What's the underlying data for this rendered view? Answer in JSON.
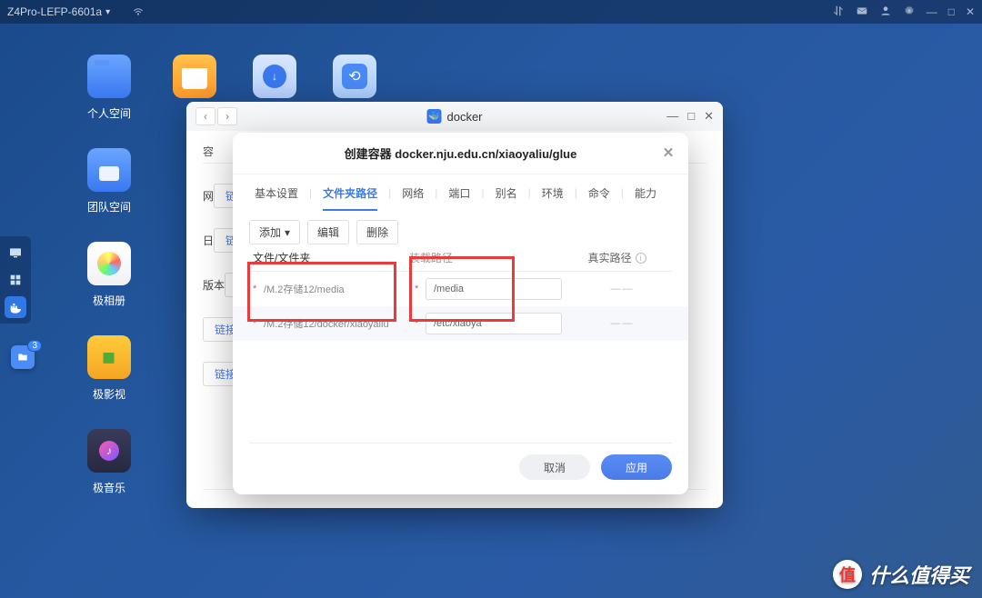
{
  "topbar": {
    "title": "Z4Pro-LEFP-6601a"
  },
  "desktop": {
    "col1": [
      {
        "label": "个人空间"
      },
      {
        "label": "团队空间"
      },
      {
        "label": "极相册"
      },
      {
        "label": "极影视"
      },
      {
        "label": "极音乐"
      }
    ]
  },
  "docker_window": {
    "title": "docker",
    "body": {
      "tab_left": "容",
      "side1": "网",
      "side2": "日",
      "side3": "版本",
      "pill_btn": "链接",
      "bottom1": "",
      "bottom2": ""
    }
  },
  "modal": {
    "title": "创建容器 docker.nju.edu.cn/xiaoyaliu/glue",
    "tabs": [
      "基本设置",
      "文件夹路径",
      "网络",
      "端口",
      "别名",
      "环境",
      "命令",
      "能力"
    ],
    "active_tab_index": 1,
    "tools": {
      "add": "添加",
      "edit": "编辑",
      "delete": "删除"
    },
    "headers": {
      "c1": "文件/文件夹",
      "c2": "装载路径",
      "c3": "真实路径"
    },
    "rows": [
      {
        "host": "/M.2存储12/media",
        "mount": "/media",
        "real": "——"
      },
      {
        "host": "/M.2存储12/docker/xiaoyaliu",
        "mount": "/etc/xiaoya",
        "real": "——"
      }
    ],
    "footer": {
      "cancel": "取消",
      "apply": "应用"
    }
  },
  "dock": {
    "badge": "3"
  },
  "watermark": {
    "text": "什么值得买",
    "logo": "值"
  }
}
